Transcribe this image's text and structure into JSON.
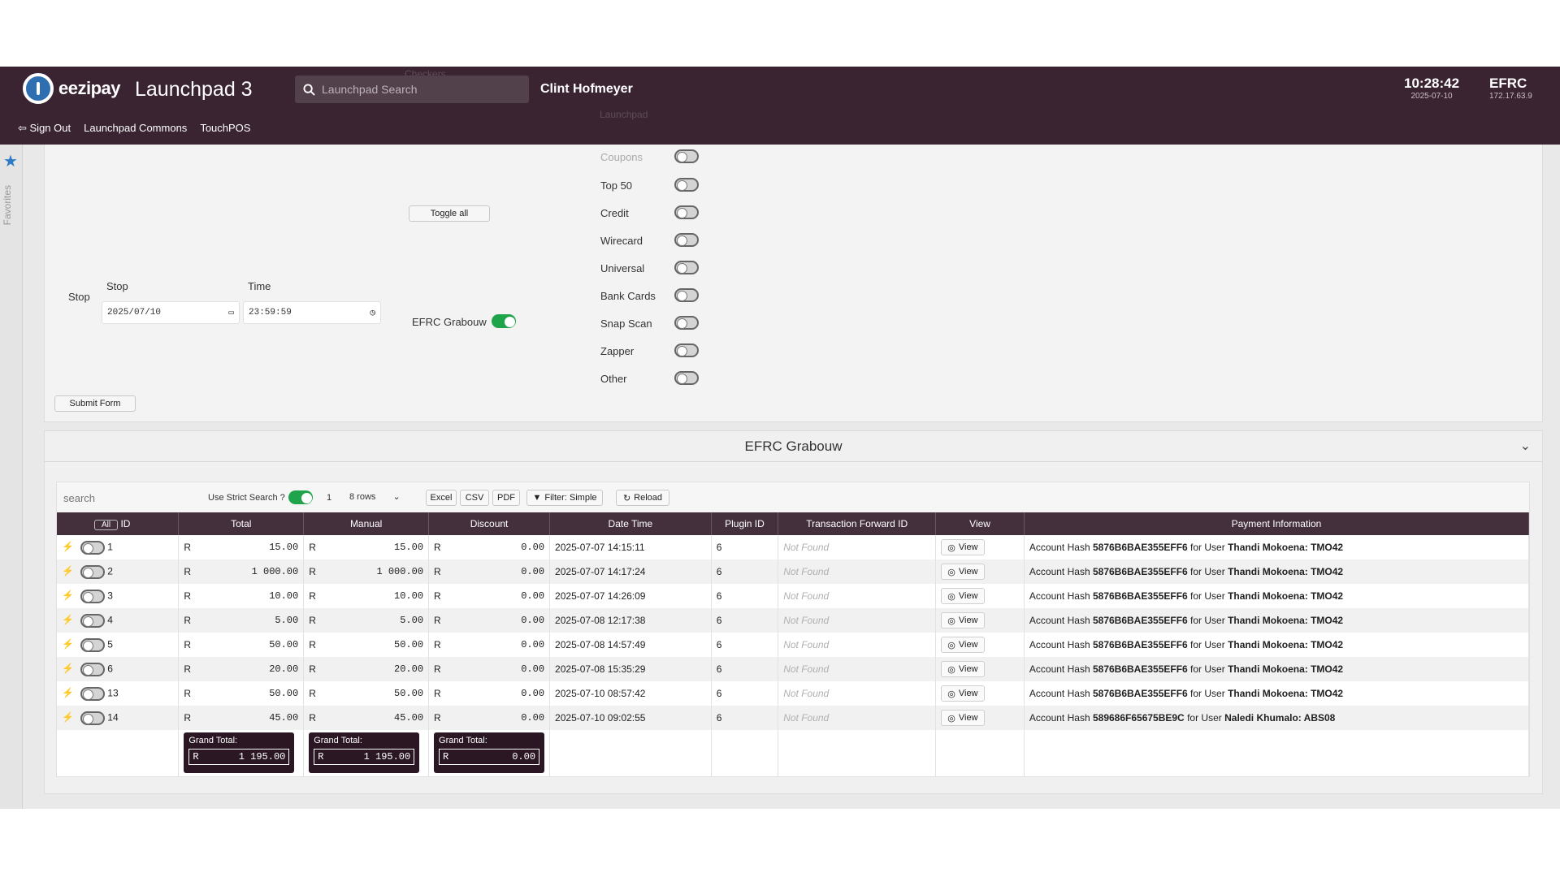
{
  "header": {
    "brand": "eezipay",
    "app_title": "Launchpad 3",
    "search_placeholder": "Launchpad Search",
    "user_name": "Clint Hofmeyer",
    "time": "10:28:42",
    "date": "2025-07-10",
    "site_code": "EFRC",
    "site_ip": "172.17.63.9",
    "nav": [
      "Sign Out",
      "Launchpad Commons",
      "TouchPOS"
    ]
  },
  "sidebar": {
    "favorites_label": "Favorites"
  },
  "form": {
    "stop_label": "Stop",
    "stop_date_label": "Stop",
    "time_label": "Time",
    "stop_date": "2025/07/10",
    "stop_time": "23:59:59",
    "toggle_all_label": "Toggle all",
    "site_toggle_label": "EFRC Grabouw",
    "submit_label": "Submit Form",
    "plugin_toggles": [
      "Top 50",
      "Credit",
      "Wirecard",
      "Universal",
      "Bank Cards",
      "Snap Scan",
      "Zapper",
      "Other"
    ],
    "ghost_labels": [
      "Checkers",
      "Launchpad",
      "Coupons"
    ]
  },
  "results": {
    "title": "EFRC Grabouw",
    "search_placeholder": "search",
    "strict_search_label": "Use Strict Search ?",
    "page_number": "1",
    "rows_select": "8 rows",
    "buttons": {
      "excel": "Excel",
      "csv": "CSV",
      "pdf": "PDF",
      "filter": "Filter: Simple",
      "reload": "Reload"
    },
    "columns": [
      "All",
      "ID",
      "Total",
      "Manual",
      "Discount",
      "Date Time",
      "Plugin ID",
      "Transaction Forward ID",
      "View",
      "Payment Information"
    ],
    "currency": "R",
    "view_label": "View",
    "not_found": "Not Found",
    "rows": [
      {
        "id": "1",
        "total": "15.00",
        "manual": "15.00",
        "discount": "0.00",
        "datetime": "2025-07-07 14:15:11",
        "plugin": "6",
        "hash": "5876B6BAE355EFF6",
        "user": "Thandi Mokoena: TMO42"
      },
      {
        "id": "2",
        "total": "1 000.00",
        "manual": "1 000.00",
        "discount": "0.00",
        "datetime": "2025-07-07 14:17:24",
        "plugin": "6",
        "hash": "5876B6BAE355EFF6",
        "user": "Thandi Mokoena: TMO42"
      },
      {
        "id": "3",
        "total": "10.00",
        "manual": "10.00",
        "discount": "0.00",
        "datetime": "2025-07-07 14:26:09",
        "plugin": "6",
        "hash": "5876B6BAE355EFF6",
        "user": "Thandi Mokoena: TMO42"
      },
      {
        "id": "4",
        "total": "5.00",
        "manual": "5.00",
        "discount": "0.00",
        "datetime": "2025-07-08 12:17:38",
        "plugin": "6",
        "hash": "5876B6BAE355EFF6",
        "user": "Thandi Mokoena: TMO42"
      },
      {
        "id": "5",
        "total": "50.00",
        "manual": "50.00",
        "discount": "0.00",
        "datetime": "2025-07-08 14:57:49",
        "plugin": "6",
        "hash": "5876B6BAE355EFF6",
        "user": "Thandi Mokoena: TMO42"
      },
      {
        "id": "6",
        "total": "20.00",
        "manual": "20.00",
        "discount": "0.00",
        "datetime": "2025-07-08 15:35:29",
        "plugin": "6",
        "hash": "5876B6BAE355EFF6",
        "user": "Thandi Mokoena: TMO42"
      },
      {
        "id": "13",
        "total": "50.00",
        "manual": "50.00",
        "discount": "0.00",
        "datetime": "2025-07-10 08:57:42",
        "plugin": "6",
        "hash": "5876B6BAE355EFF6",
        "user": "Thandi Mokoena: TMO42"
      },
      {
        "id": "14",
        "total": "45.00",
        "manual": "45.00",
        "discount": "0.00",
        "datetime": "2025-07-10 09:02:55",
        "plugin": "6",
        "hash": "589686F65675BE9C",
        "user": "Naledi Khumalo: ABS08"
      }
    ],
    "payment_prefix": "Account Hash",
    "payment_mid": "for User",
    "grand_total_label": "Grand Total:",
    "grand_totals": {
      "total": "1 195.00",
      "manual": "1 195.00",
      "discount": "0.00"
    }
  },
  "colors": {
    "header_bg": "#3a2432",
    "toggle_on": "#1fa44b",
    "accent": "#2d7ac6"
  }
}
